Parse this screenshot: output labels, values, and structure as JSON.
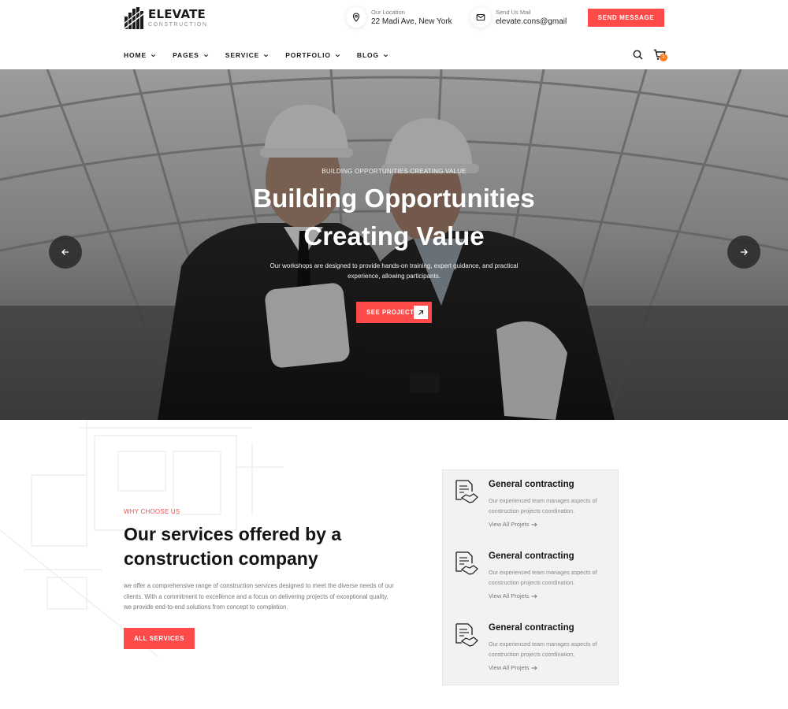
{
  "brand": {
    "name": "ELEVATE",
    "tagline": "CONSTRUCTION"
  },
  "header": {
    "location_label": "Our Location",
    "location_value": "22 Madi Ave, New York",
    "mail_label": "Send Us Mail",
    "mail_value": "elevate.cons@gmail",
    "cta_label": "SEND MESSAGE"
  },
  "nav": {
    "items": [
      {
        "label": "HOME",
        "icon": "chevron-down-icon"
      },
      {
        "label": "PAGES",
        "icon": "chevron-down-icon"
      },
      {
        "label": "SERVICE",
        "icon": "chevron-down-icon"
      },
      {
        "label": "PORTFOLIO",
        "icon": "chevron-down-icon"
      },
      {
        "label": "BLOG",
        "icon": "chevron-down-icon"
      }
    ],
    "cart_count": "2"
  },
  "hero": {
    "eyebrow": "BUILDING OPPORTUNITIES CREATING VALUE",
    "title": "Building Opportunities Creating Value",
    "text": "Our workshops are designed to provide hands-on training, expert guidance, and practical experience, allowing participants.",
    "button_label": "SEE PROJECT"
  },
  "services": {
    "eyebrow": "WHY CHOOSE US",
    "title": "Our services offered by a construction company",
    "text": "we offer a comprehensive range of construction services designed to meet the diverse needs of our clients. With a commitment to excellence and a focus on delivering projects of exceptional quality, we provide end-to-end solutions from concept to completion.",
    "button_label": "ALL SERVICES",
    "cards": [
      {
        "title": "General contracting",
        "desc": "Our experienced team manages aspects of construction projects coordination.",
        "link": "View All Projets"
      },
      {
        "title": "General contracting",
        "desc": "Our experienced team manages aspects of construction projects coordination.",
        "link": "View All Projets"
      },
      {
        "title": "General contracting",
        "desc": "Our experienced team manages aspects of construction projects coordination.",
        "link": "View All Projets"
      }
    ]
  },
  "colors": {
    "accent": "#ff4a4a",
    "badge": "#ff7a1a",
    "text_dark": "#141414",
    "panel_bg": "#f2f2f2"
  }
}
